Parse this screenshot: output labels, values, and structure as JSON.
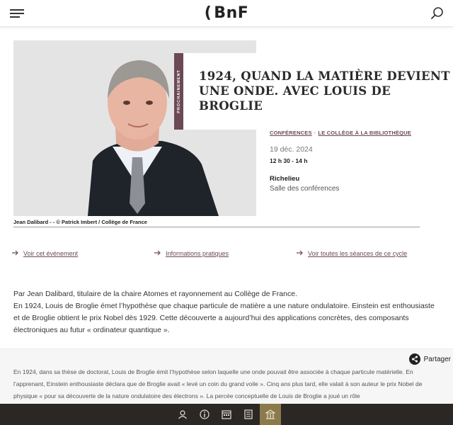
{
  "header": {
    "logo_bracket": "(",
    "logo_text": "BnF"
  },
  "hero": {
    "badge": "PROCHAINEMENT",
    "title": "1924, quand la matière devient une onde. Avec Louis de Broglie",
    "photo_caption": "Jean Dalibard - - © Patrick Imbert / Collège de France"
  },
  "event": {
    "categories": [
      "CONFÉRENCES",
      "LE COLLÈGE À LA BIBLIOTHÈQUE"
    ],
    "category_separator": "·",
    "date": "19 déc. 2024",
    "hours": "12 h 30 - 14 h",
    "site": "Richelieu",
    "room": "Salle des conférences"
  },
  "links": [
    {
      "label": "Voir cet événement"
    },
    {
      "label": "Informations pratiques"
    },
    {
      "label": "Voir toutes les séances de ce cycle"
    }
  ],
  "intro": {
    "line1": "Par Jean Dalibard, titulaire de la chaire Atomes et rayonnement au Collège de France.",
    "line2": "En 1924, Louis de Broglie émet l’hypothèse que chaque particule de matière a une nature ondulatoire. Einstein est enthousiaste et de Broglie obtient le prix Nobel dès 1929. Cette découverte a aujourd’hui des applications concrètes, des composants électroniques au futur « ordinateur quantique »."
  },
  "share": {
    "label": "Partager"
  },
  "description": {
    "text": "En 1924, dans sa thèse de doctorat, Louis de Broglie émit l’hypothèse selon laquelle une onde pouvait être associée à chaque particule matérielle. En l’apprenant, Einstein enthousiaste déclara que de Broglie avait « levé un coin du grand voile ». Cinq ans plus tard, elle valait à son auteur le prix Nobel de physique « pour sa découverte de la nature ondulatoire des électrons ». La percée conceptuelle de Louis de Broglie a joué un rôle"
  },
  "bottom_nav": {
    "items": [
      "user-icon",
      "info-icon",
      "calendar-icon",
      "document-icon",
      "building-icon"
    ],
    "active": "building-icon"
  },
  "colors": {
    "accent": "#6b4a55",
    "nav_bg": "#2b2724",
    "nav_active": "#8b7a4c"
  }
}
